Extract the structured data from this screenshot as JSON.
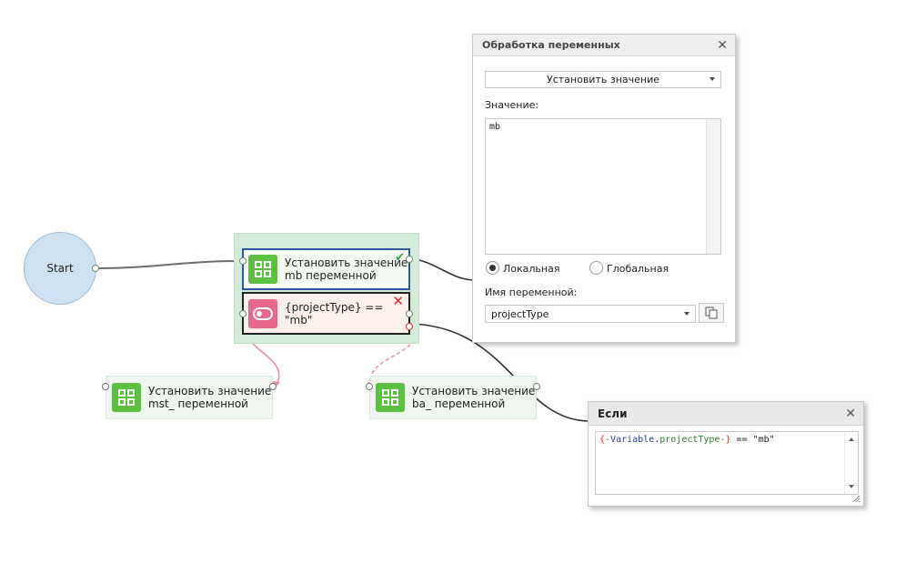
{
  "flow": {
    "start_label": "Start",
    "block_set_mb": "Установить значение\nmb переменной",
    "block_condition": "{projectType} ==\n\"mb\"",
    "block_set_mst": "Установить значение\nmst_ переменной",
    "block_set_ba": "Установить значение\nba_ переменной"
  },
  "variable_panel": {
    "title": "Обработка переменных",
    "action_select": "Установить значение",
    "value_label": "Значение:",
    "value_text": "mb",
    "scope_local": "Локальная",
    "scope_global": "Глобальная",
    "scope_selected": "local",
    "var_name_label": "Имя переменной:",
    "var_name_value": "projectType"
  },
  "if_panel": {
    "title": "Если",
    "expr_open": "{-",
    "expr_var": "Variable",
    "expr_dot": ".",
    "expr_prop": "projectType",
    "expr_close": "-}",
    "expr_rest": " == \"mb\""
  },
  "colors": {
    "block_icon_green": "#5bbf3f",
    "block_icon_pink": "#e8678a",
    "selected_border": "#2a5a9c",
    "error_mark": "#e2262e",
    "ok_mark": "#3aa14a"
  }
}
